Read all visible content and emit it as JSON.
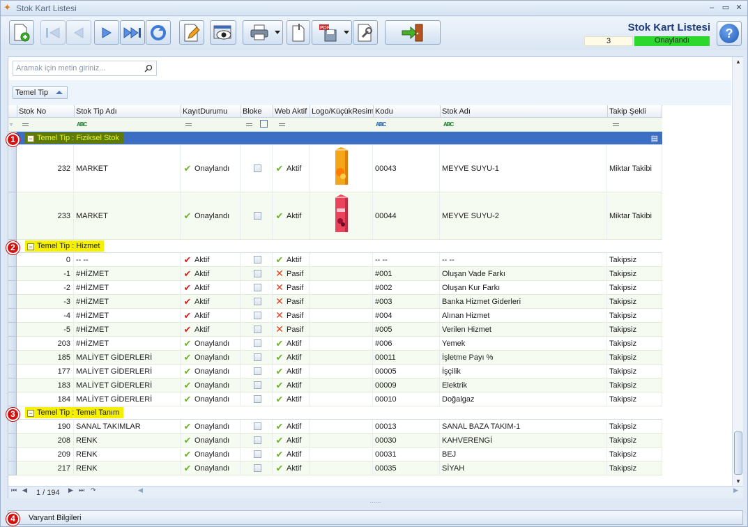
{
  "window": {
    "title": "Stok Kart Listesi"
  },
  "header": {
    "title": "Stok Kart Listesi",
    "count": "3",
    "status": "Onaylandı",
    "status_color": "#2bd82b"
  },
  "toolbar": {
    "buttons": [
      "new-icon",
      "first-icon",
      "prev-icon",
      "next-icon",
      "last-icon",
      "refresh-icon",
      "edit-icon",
      "preview-icon",
      "print-icon",
      "copy-icon",
      "pdf-save-icon",
      "settings-icon",
      "exit-icon"
    ]
  },
  "search": {
    "placeholder": "Aramak için metin giriniz..."
  },
  "grouping": {
    "chip": "Temel Tip"
  },
  "columns": [
    "Stok No",
    "Stok Tip Adı",
    "KayıtDurumu",
    "Bloke",
    "Web Aktif",
    "Logo/KüçükResim",
    "Kodu",
    "Stok Adı",
    "Takip Şekli"
  ],
  "groups": [
    {
      "label": "Temel Tip : Fiziksel Stok",
      "badge": "1",
      "rows": [
        {
          "no": "232",
          "tip": "MARKET",
          "durum": "Onaylandı",
          "durum_icon": "check",
          "web": "Aktif",
          "web_icon": "check",
          "kodu": "00043",
          "ad": "MEYVE SUYU-1",
          "takip": "Miktar Takibi",
          "img": "orange-juice-carton"
        },
        {
          "no": "233",
          "tip": "MARKET",
          "durum": "Onaylandı",
          "durum_icon": "check",
          "web": "Aktif",
          "web_icon": "check",
          "kodu": "00044",
          "ad": "MEYVE SUYU-2",
          "takip": "Miktar Takibi",
          "img": "berry-juice-carton"
        }
      ]
    },
    {
      "label": "Temel Tip : Hizmet",
      "badge": "2",
      "rows": [
        {
          "no": "0",
          "tip": "-- --",
          "durum": "Aktif",
          "durum_icon": "redcheck",
          "web": "Aktif",
          "web_icon": "check",
          "kodu": "-- --",
          "ad": "-- --",
          "takip": "Takipsiz"
        },
        {
          "no": "-1",
          "tip": "#HİZMET",
          "durum": "Aktif",
          "durum_icon": "redcheck",
          "web": "Pasif",
          "web_icon": "x",
          "kodu": "#001",
          "ad": "Oluşan Vade Farkı",
          "takip": "Takipsiz"
        },
        {
          "no": "-2",
          "tip": "#HİZMET",
          "durum": "Aktif",
          "durum_icon": "redcheck",
          "web": "Pasif",
          "web_icon": "x",
          "kodu": "#002",
          "ad": "Oluşan Kur Farkı",
          "takip": "Takipsiz"
        },
        {
          "no": "-3",
          "tip": "#HİZMET",
          "durum": "Aktif",
          "durum_icon": "redcheck",
          "web": "Pasif",
          "web_icon": "x",
          "kodu": "#003",
          "ad": "Banka Hizmet Giderleri",
          "takip": "Takipsiz"
        },
        {
          "no": "-4",
          "tip": "#HİZMET",
          "durum": "Aktif",
          "durum_icon": "redcheck",
          "web": "Pasif",
          "web_icon": "x",
          "kodu": "#004",
          "ad": "Alınan Hizmet",
          "takip": "Takipsiz"
        },
        {
          "no": "-5",
          "tip": "#HİZMET",
          "durum": "Aktif",
          "durum_icon": "redcheck",
          "web": "Pasif",
          "web_icon": "x",
          "kodu": "#005",
          "ad": "Verilen Hizmet",
          "takip": "Takipsiz"
        },
        {
          "no": "203",
          "tip": "#HİZMET",
          "durum": "Onaylandı",
          "durum_icon": "check",
          "web": "Aktif",
          "web_icon": "check",
          "kodu": "#006",
          "ad": "Yemek",
          "takip": "Takipsiz"
        },
        {
          "no": "185",
          "tip": "MALİYET GİDERLERİ",
          "durum": "Onaylandı",
          "durum_icon": "check",
          "web": "Aktif",
          "web_icon": "check",
          "kodu": "00011",
          "ad": "İşletme Payı %",
          "takip": "Takipsiz"
        },
        {
          "no": "177",
          "tip": "MALİYET GİDERLERİ",
          "durum": "Onaylandı",
          "durum_icon": "check",
          "web": "Aktif",
          "web_icon": "check",
          "kodu": "00005",
          "ad": "İşçilik",
          "takip": "Takipsiz"
        },
        {
          "no": "183",
          "tip": "MALİYET GİDERLERİ",
          "durum": "Onaylandı",
          "durum_icon": "check",
          "web": "Aktif",
          "web_icon": "check",
          "kodu": "00009",
          "ad": "Elektrik",
          "takip": "Takipsiz"
        },
        {
          "no": "184",
          "tip": "MALİYET GİDERLERİ",
          "durum": "Onaylandı",
          "durum_icon": "check",
          "web": "Aktif",
          "web_icon": "check",
          "kodu": "00010",
          "ad": "Doğalgaz",
          "takip": "Takipsiz"
        }
      ]
    },
    {
      "label": "Temel Tip : Temel Tanım",
      "badge": "3",
      "rows": [
        {
          "no": "190",
          "tip": "SANAL TAKIMLAR",
          "durum": "Onaylandı",
          "durum_icon": "check",
          "web": "Aktif",
          "web_icon": "check",
          "kodu": "00013",
          "ad": "SANAL BAZA TAKIM-1",
          "takip": "Takipsiz"
        },
        {
          "no": "208",
          "tip": "RENK",
          "durum": "Onaylandı",
          "durum_icon": "check",
          "web": "Aktif",
          "web_icon": "check",
          "kodu": "00030",
          "ad": "KAHVERENGİ",
          "takip": "Takipsiz"
        },
        {
          "no": "209",
          "tip": "RENK",
          "durum": "Onaylandı",
          "durum_icon": "check",
          "web": "Aktif",
          "web_icon": "check",
          "kodu": "00031",
          "ad": "BEJ",
          "takip": "Takipsiz"
        },
        {
          "no": "217",
          "tip": "RENK",
          "durum": "Onaylandı",
          "durum_icon": "check",
          "web": "Aktif",
          "web_icon": "check",
          "kodu": "00035",
          "ad": "SİYAH",
          "takip": "Takipsiz"
        }
      ]
    }
  ],
  "pager": {
    "position": "1 / 194"
  },
  "bottom": {
    "label": "Varyant Bilgileri",
    "badge": "4"
  }
}
